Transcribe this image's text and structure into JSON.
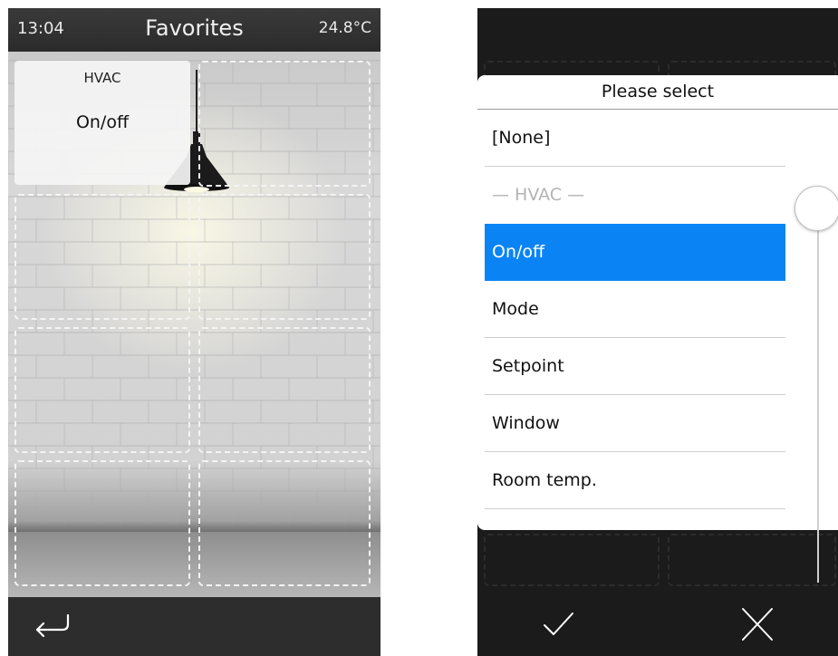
{
  "left_screen": {
    "status_bar": {
      "time": "13:04",
      "title": "Favorites",
      "temperature": "24.8°C"
    },
    "tile": {
      "category": "HVAC",
      "function": "On/off"
    },
    "bottom_bar": {
      "back_icon": "return-arrow-icon"
    }
  },
  "right_screen": {
    "dialog": {
      "title": "Please select",
      "options": [
        {
          "label": "[None]",
          "type": "item"
        },
        {
          "label": "— HVAC —",
          "type": "group-header"
        },
        {
          "label": "On/off",
          "type": "item",
          "selected": true
        },
        {
          "label": "Mode",
          "type": "item"
        },
        {
          "label": "Setpoint",
          "type": "item"
        },
        {
          "label": "Window",
          "type": "item"
        },
        {
          "label": "Room temp.",
          "type": "item"
        }
      ],
      "scroll_position": 0
    },
    "bottom_bar": {
      "confirm_icon": "checkmark-icon",
      "cancel_icon": "close-icon"
    }
  },
  "colors": {
    "accent": "#0a84f5",
    "status_bar": "#333333",
    "bottom_bar": "#2d2d2d"
  }
}
